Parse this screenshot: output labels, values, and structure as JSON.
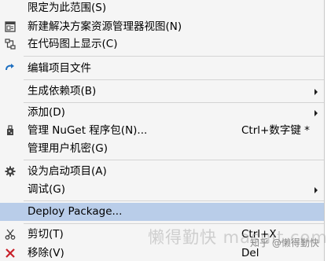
{
  "menu": {
    "items": [
      {
        "label": "限定为此范围(S)"
      },
      {
        "label": "新建解决方案资源管理器视图(N)",
        "icon": "new-explorer-view-icon"
      },
      {
        "label": "在代码图上显示(C)",
        "icon": "code-map-icon"
      },
      {
        "label": "编辑项目文件",
        "icon": "edit-project-file-icon"
      },
      {
        "label": "生成依赖项(B)",
        "submenu": true
      },
      {
        "label": "添加(D)",
        "submenu": true
      },
      {
        "label": "管理 NuGet 程序包(N)...",
        "shortcut": "Ctrl+数字键 *",
        "icon": "nuget-icon"
      },
      {
        "label": "管理用户机密(G)"
      },
      {
        "label": "设为启动项目(A)",
        "icon": "gear-icon"
      },
      {
        "label": "调试(G)",
        "submenu": true
      },
      {
        "label": "Deploy Package...",
        "highlighted": true
      },
      {
        "label": "剪切(T)",
        "shortcut": "Ctrl+X",
        "icon": "scissors-icon"
      },
      {
        "label": "移除(V)",
        "shortcut": "Del",
        "icon": "remove-icon"
      }
    ]
  },
  "watermark": {
    "text": "懒得勤快 masuit.com",
    "zhihu": "知乎 @懒得勤快"
  },
  "colors": {
    "menu_background": "#f5f5f5",
    "highlight": "#b9cde9",
    "separator": "#d4d4d4",
    "icon_blue": "#1e6fc0",
    "icon_red": "#c8202a"
  }
}
